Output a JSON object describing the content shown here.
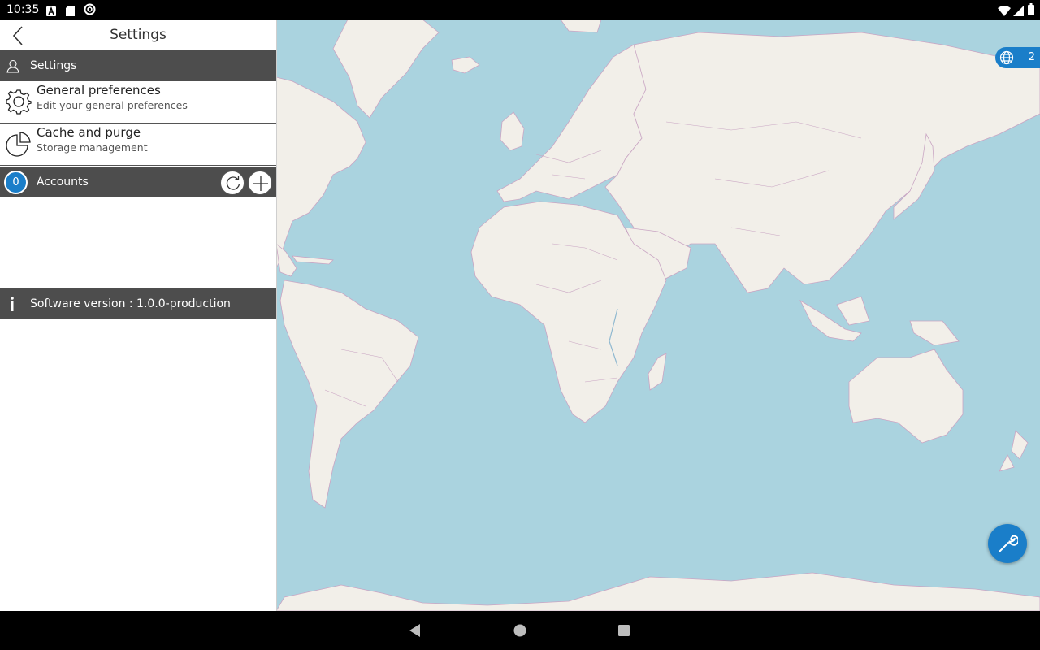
{
  "status_bar": {
    "time": "10:35",
    "left_icons": [
      "font-download-icon",
      "sd-card-icon",
      "sync-icon"
    ],
    "right_icons": [
      "wifi-icon",
      "signal-icon",
      "battery-icon"
    ]
  },
  "panel": {
    "title": "Settings",
    "back_icon": "chevron-left-icon",
    "settings_section": {
      "label": "Settings",
      "icon": "person-outline-icon"
    },
    "items": [
      {
        "title": "General preferences",
        "subtitle": "Edit your general preferences",
        "icon": "gear-icon"
      },
      {
        "title": "Cache and purge",
        "subtitle": "Storage management",
        "icon": "pie-chart-icon"
      }
    ],
    "accounts": {
      "count": "0",
      "label": "Accounts",
      "refresh_icon": "refresh-icon",
      "add_icon": "plus-icon"
    },
    "version": {
      "icon": "info-icon",
      "label": "Software version : 1.0.0-production"
    }
  },
  "map": {
    "layer_count": "2",
    "layer_icon": "globe-icon",
    "tools_icon": "wrench-icon"
  },
  "colors": {
    "accent": "#1a7ec9",
    "section_bar": "#4d4d4d",
    "water": "#aad3df",
    "land": "#f2efe9",
    "border": "#c9a5c3"
  },
  "nav_bar": {
    "icons": [
      "back-triangle-icon",
      "home-circle-icon",
      "recents-square-icon"
    ]
  }
}
